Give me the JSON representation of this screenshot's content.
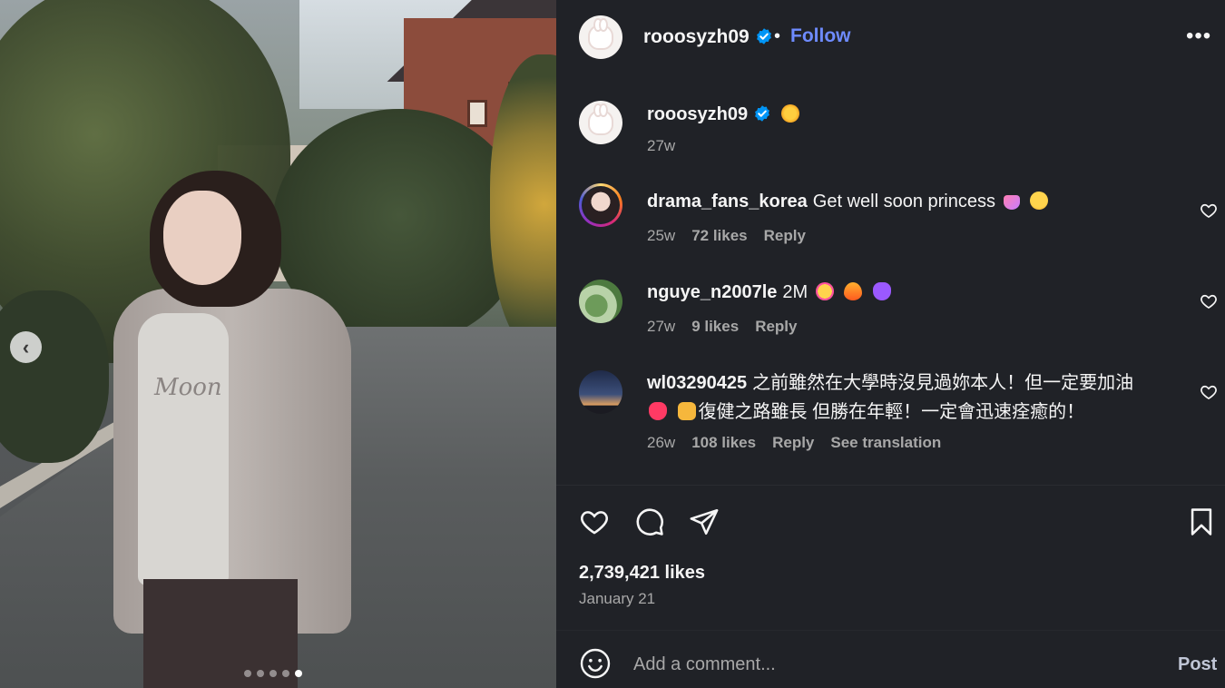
{
  "photo": {
    "sweater_print": "Moon",
    "carousel_count": 5,
    "carousel_active_index": 4,
    "prev_icon": "chevron-left-icon"
  },
  "header": {
    "username": "rooosyzh09",
    "separator": "•",
    "follow_label": "Follow",
    "more_icon": "more-horizontal-icon",
    "more_glyph": "•••"
  },
  "caption": {
    "username": "rooosyzh09",
    "time": "27w"
  },
  "comments": [
    {
      "username": "drama_fans_korea",
      "text": "Get well soon princess",
      "time": "25w",
      "likes": "72 likes",
      "reply": "Reply"
    },
    {
      "username": "nguye_n2007le",
      "text": "2M",
      "time": "27w",
      "likes": "9 likes",
      "reply": "Reply"
    },
    {
      "username": "wl03290425",
      "text": "之前雖然在大學時沒見過妳本人！但一定要加油",
      "text2": "復健之路雖長 但勝在年輕！一定會迅速痊癒的！",
      "time": "26w",
      "likes": "108 likes",
      "reply": "Reply",
      "translate": "See translation"
    }
  ],
  "post": {
    "likes": "2,739,421 likes",
    "date": "January 21"
  },
  "add_comment": {
    "placeholder": "Add a comment...",
    "post_label": "Post"
  },
  "colors": {
    "background": "#202227",
    "follow": "#6e8bff",
    "verified": "#0095f6",
    "muted_text": "#a8a8a8"
  }
}
